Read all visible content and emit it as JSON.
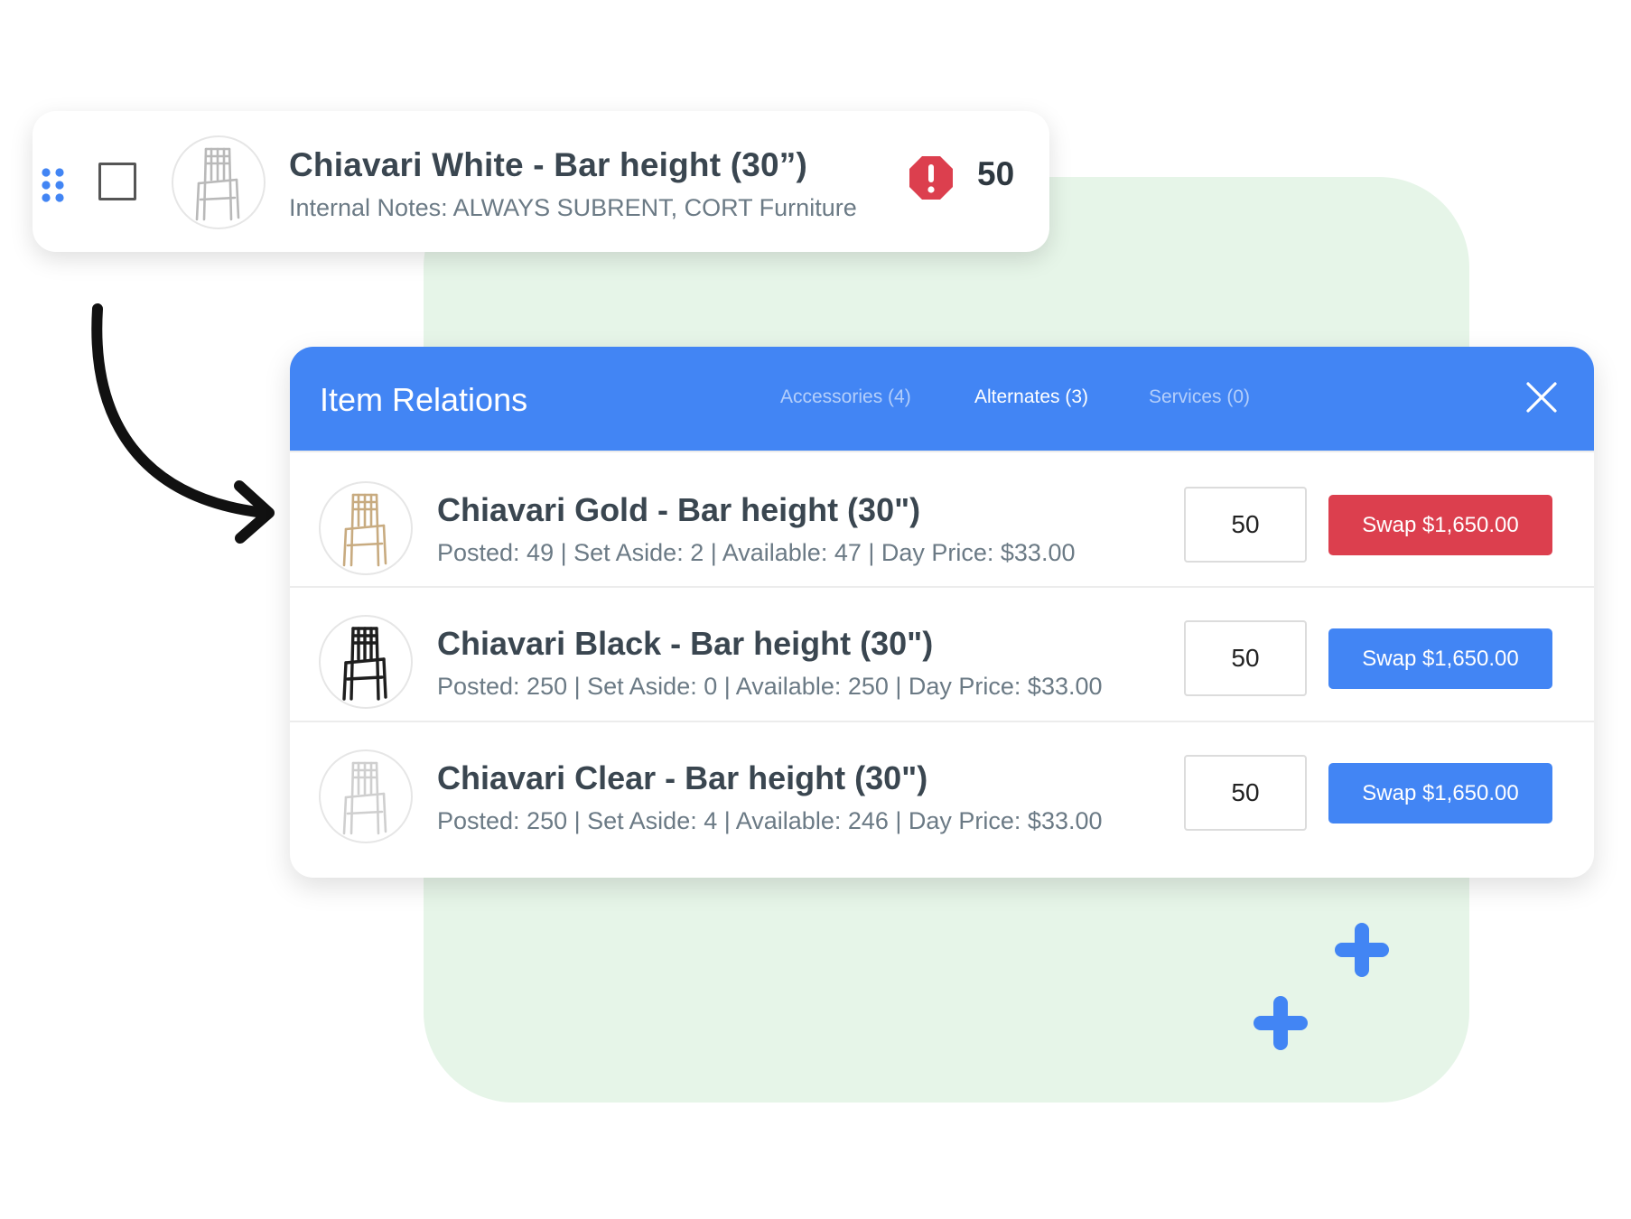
{
  "item": {
    "title": "Chiavari White - Bar height (30”)",
    "notes": "Internal Notes: ALWAYS SUBRENT, CORT Furniture",
    "quantity": "50",
    "chair_color": "#b9b9b9"
  },
  "modal": {
    "title": "Item Relations",
    "tabs": {
      "accessories": "Accessories (4)",
      "alternates": "Alternates (3)",
      "services": "Services (0)"
    },
    "rows": [
      {
        "title": "Chiavari Gold - Bar height (30\")",
        "stats": "Posted: 49 | Set Aside: 2 | Available: 47 | Day Price: $33.00",
        "quantity": "50",
        "swap_label": "Swap $1,650.00",
        "swap_color": "#dc3f4e",
        "chair_color": "#c8ab80"
      },
      {
        "title": "Chiavari Black - Bar height (30\")",
        "stats": "Posted: 250 | Set Aside: 0 | Available: 250 | Day Price: $33.00",
        "quantity": "50",
        "swap_label": "Swap $1,650.00",
        "swap_color": "#4285f4",
        "chair_color": "#1e1e1e"
      },
      {
        "title": "Chiavari Clear - Bar height (30\")",
        "stats": "Posted: 250 | Set Aside: 4 | Available: 246 | Day Price: $33.00",
        "quantity": "50",
        "swap_label": "Swap $1,650.00",
        "swap_color": "#4285f4",
        "chair_color": "#cfcfcf"
      }
    ]
  },
  "colors": {
    "header_blue": "#4285f4",
    "blob_green": "#e6f5e8",
    "warning_red": "#dc3f4e"
  }
}
